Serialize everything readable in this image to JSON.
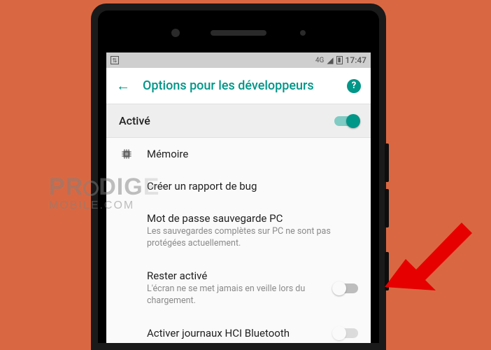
{
  "statusbar": {
    "usb": "⇅",
    "network": "4G",
    "signal": "◢",
    "battery": "▮",
    "time": "17:47"
  },
  "appbar": {
    "title": "Options pour les développeurs",
    "help": "?"
  },
  "master": {
    "label": "Activé",
    "on": true
  },
  "rows": {
    "memory": {
      "title": "Mémoire"
    },
    "bugreport": {
      "title": "Créer un rapport de bug"
    },
    "backup": {
      "title": "Mot de passe sauvegarde PC",
      "sub": "Les sauvegardes complètes sur PC ne sont pas protégées actuellement."
    },
    "stayawake": {
      "title": "Rester activé",
      "sub": "L'écran ne se met jamais en veille lors du chargement.",
      "on": false
    },
    "bthci": {
      "title": "Activer journaux HCI Bluetooth"
    }
  },
  "watermark": {
    "l1a": "PR",
    "l1b": "DIG",
    "l2": "MOBILE.COM"
  }
}
